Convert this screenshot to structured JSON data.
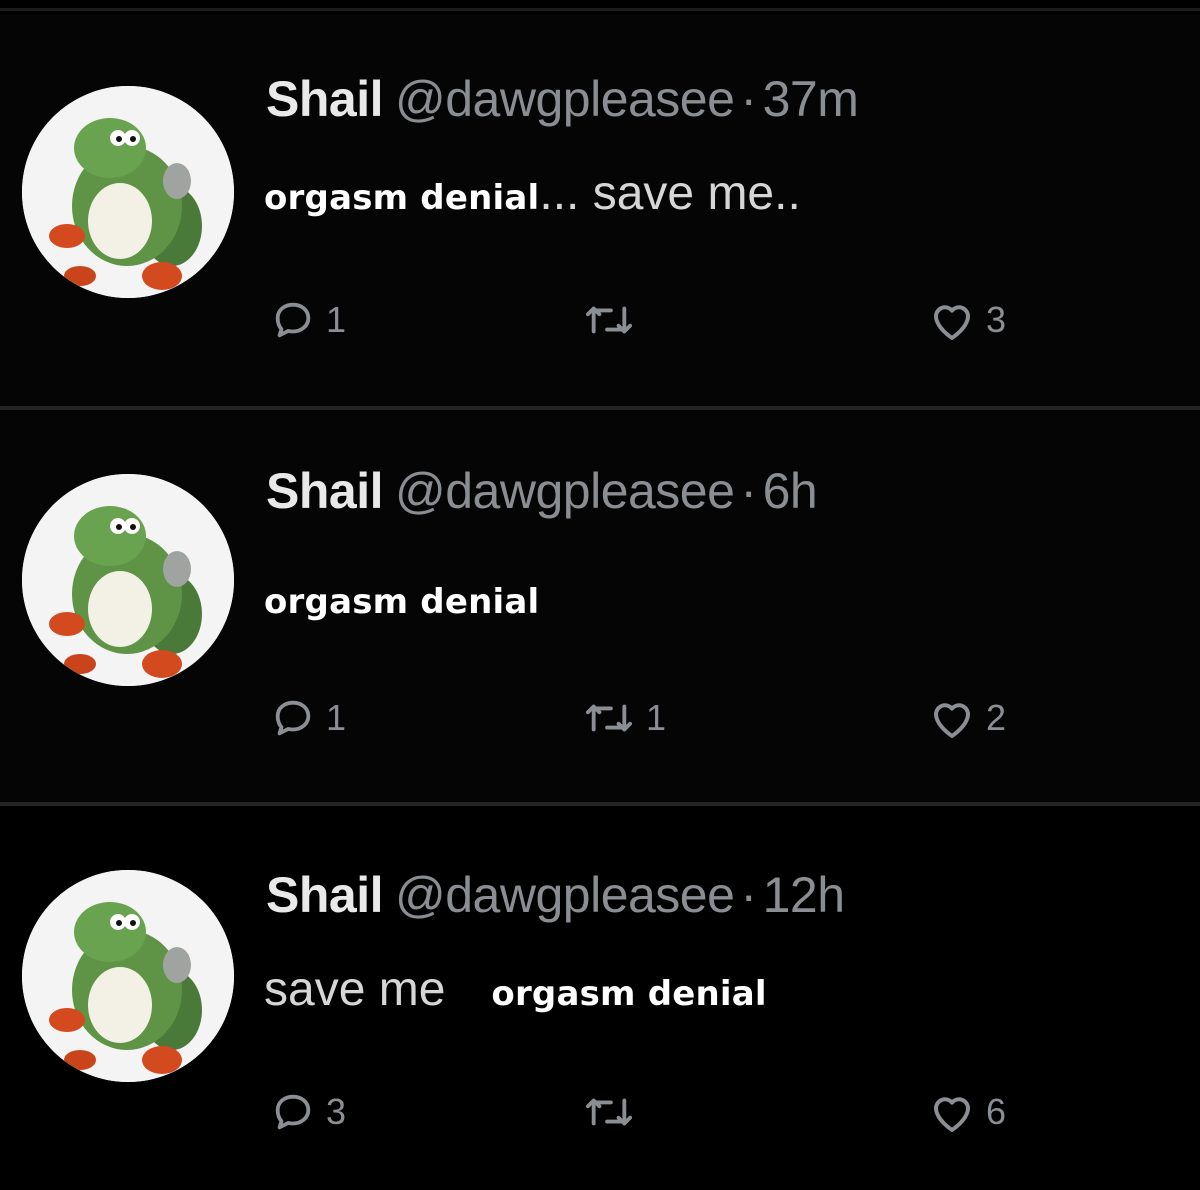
{
  "tweets": [
    {
      "name": "Shail",
      "handle": "@dawgpleasee",
      "separator": "·",
      "time": "37m",
      "text_white": "orgasm denial",
      "text_gray": "... save me..",
      "text_order": "white-first",
      "replies": "1",
      "retweets": "",
      "likes": "3"
    },
    {
      "name": "Shail",
      "handle": "@dawgpleasee",
      "separator": "·",
      "time": "6h",
      "text_white": "orgasm denial",
      "text_gray": "",
      "text_order": "white-first",
      "replies": "1",
      "retweets": "1",
      "likes": "2"
    },
    {
      "name": "Shail",
      "handle": "@dawgpleasee",
      "separator": "·",
      "time": "12h",
      "text_white": "orgasm denial",
      "text_gray": "save me",
      "text_order": "gray-first",
      "replies": "3",
      "retweets": "",
      "likes": "6"
    }
  ],
  "icons": {
    "reply": "reply-bubble-icon",
    "retweet": "retweet-arrows-icon",
    "like": "heart-outline-icon",
    "avatar": "yoshi-avatar"
  },
  "colors": {
    "background": "#000000",
    "name": "#e9e9e9",
    "muted": "#8a8d91",
    "caption": "#ffffff"
  }
}
